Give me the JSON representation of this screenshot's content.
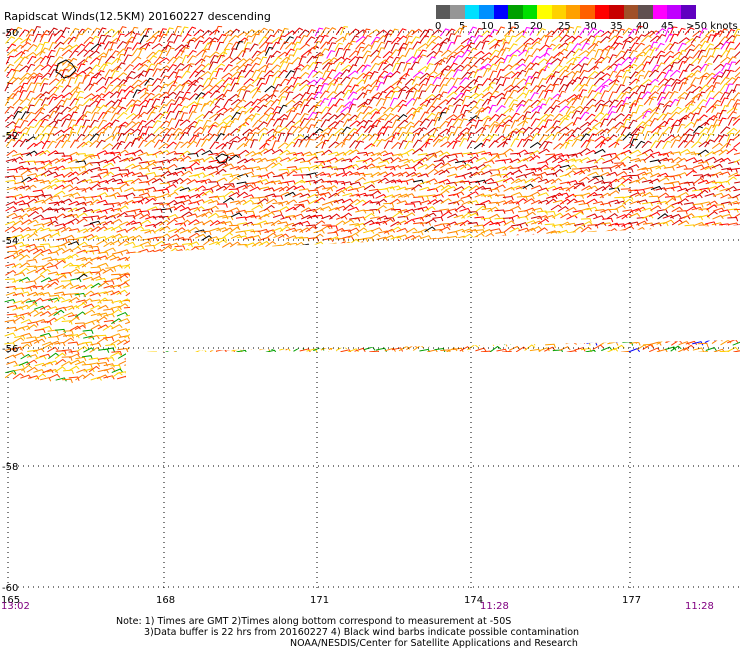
{
  "title": "Rapidscat Winds(12.5KM) 20160227 descending",
  "colorbar": {
    "colors": [
      "#5a5a5a",
      "#969696",
      "#00e0ff",
      "#0090ff",
      "#0000ff",
      "#00a000",
      "#00e000",
      "#ffff00",
      "#ffd200",
      "#ffa000",
      "#ff6000",
      "#ff0000",
      "#c80000",
      "#a05028",
      "#605050",
      "#ff00ff",
      "#c000ff",
      "#6000c0"
    ],
    "ticks": [
      "0",
      "5",
      "10",
      "15",
      "20",
      "25",
      "30",
      "35",
      "40",
      "45",
      ">50 knots"
    ]
  },
  "axes": {
    "lat_labels": [
      "-50",
      "-52",
      "-54",
      "-56",
      "-58",
      "-60"
    ],
    "lon_labels": [
      "165",
      "168",
      "171",
      "174",
      "177"
    ]
  },
  "times": [
    "13:02",
    "11:28",
    "11:28"
  ],
  "notes": {
    "line1": "Note: 1) Times are GMT 2)Times along bottom correspond to measurement at -50S",
    "line2": "3)Data buffer is 22 hrs from 20160227 4) Black wind barbs indicate possible contamination",
    "line3": "NOAA/NESDIS/Center for Satellite Applications and Research"
  },
  "palette": {
    "time_color": "#800080",
    "barb_colors": [
      "#ff0000",
      "#e00000",
      "#ff4000",
      "#ff8000",
      "#ffa000",
      "#ffd000",
      "#c80000",
      "#ff00ff",
      "#c000ff",
      "#00a000",
      "#0000ff",
      "#000000"
    ]
  }
}
